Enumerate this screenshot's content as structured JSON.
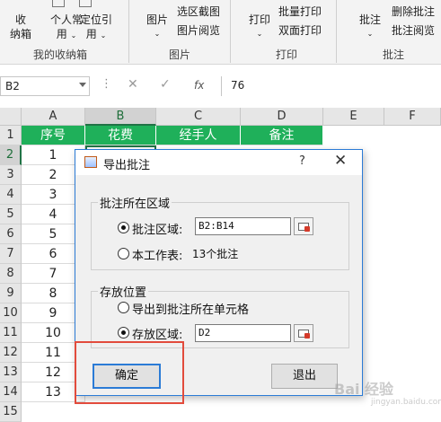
{
  "ribbon": {
    "btn_collapse_a": "收",
    "btn_collapse_b": "纳箱",
    "btn_personal_a": "个人常",
    "btn_personal_b": "用",
    "btn_locate_a": "定位引",
    "btn_locate_b": "用",
    "btn_picture": "图片",
    "btn_region_capture": "选区截图",
    "btn_picture_view": "图片阅览",
    "btn_print": "打印",
    "btn_batch_print": "批量打印",
    "btn_duplex_print": "双面打印",
    "btn_comment": "批注",
    "btn_delete_comment": "删除批注",
    "btn_comment_view": "批注阅览",
    "group_my_box": "我的收纳箱",
    "group_picture": "图片",
    "group_print": "打印",
    "group_comment": "批注"
  },
  "formula_bar": {
    "name_box": "B2",
    "cancel_icon": "close-icon",
    "enter_icon": "check-icon",
    "fx": "fx",
    "value": "76"
  },
  "sheet": {
    "columns": [
      "A",
      "B",
      "C",
      "D",
      "E",
      "F"
    ],
    "rows": [
      "1",
      "2",
      "3",
      "4",
      "5",
      "6",
      "7",
      "8",
      "9",
      "10",
      "11",
      "12",
      "13",
      "14",
      "15"
    ],
    "header_row": [
      "序号",
      "花费",
      "经手人",
      "备注"
    ],
    "col_a_values": [
      "1",
      "2",
      "3",
      "4",
      "5",
      "6",
      "7",
      "8",
      "9",
      "10",
      "11",
      "12",
      "13"
    ],
    "selected_cell": "B2",
    "header_fill": "#1fb05a"
  },
  "dialog": {
    "title": "导出批注",
    "help": "?",
    "close": "✕",
    "group1_title": "批注所在区域",
    "opt_comment_range": "批注区域:",
    "comment_range_value": "B2:B14",
    "opt_current_sheet": "本工作表:",
    "current_sheet_count": "13个批注",
    "group2_title": "存放位置",
    "opt_export_to_cell": "导出到批注所在单元格",
    "opt_store_range": "存放区域:",
    "store_range_value": "D2",
    "ok": "确定",
    "exit": "退出",
    "accent": "#2b7bd6",
    "highlight": "#e24b3c"
  },
  "watermark": {
    "text": "Bai 经验",
    "sub": "jingyan.baidu.com"
  }
}
